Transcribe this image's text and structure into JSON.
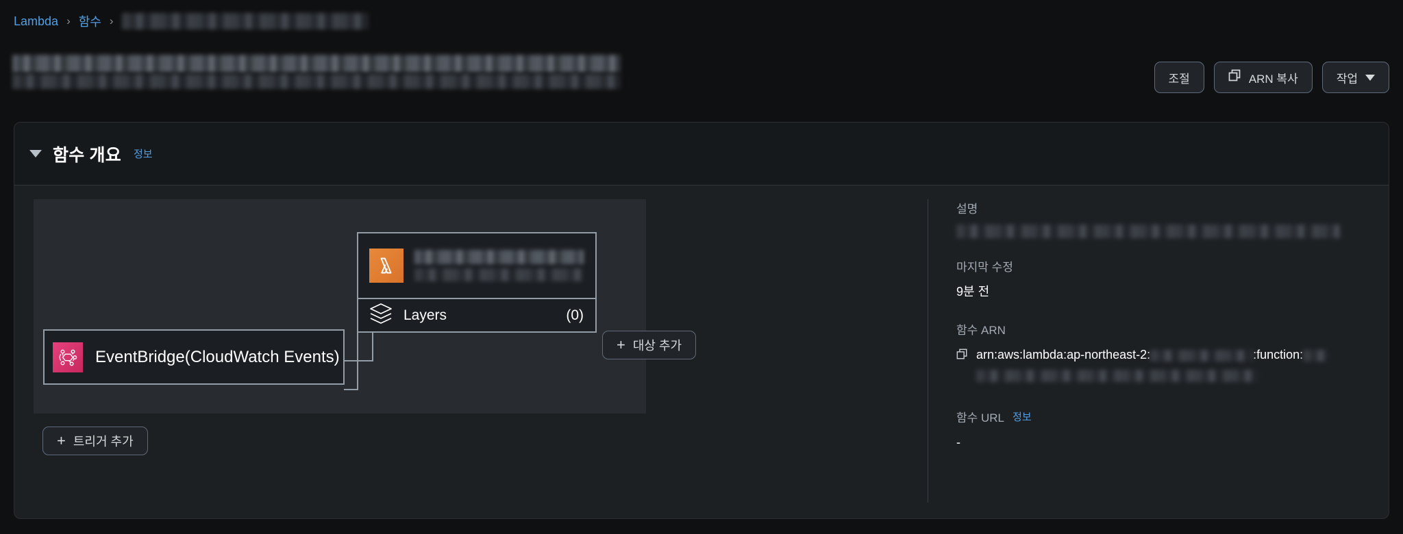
{
  "breadcrumb": {
    "items": [
      {
        "label": "Lambda",
        "link": true
      },
      {
        "label": "함수",
        "link": true
      }
    ],
    "separator": "›",
    "current_redacted": true
  },
  "page_title": {
    "redacted": true
  },
  "header_actions": {
    "throttle_label": "조절",
    "copy_arn_label": "ARN 복사",
    "copy_arn_icon": "copy-icon",
    "actions_label": "작업",
    "actions_caret_icon": "chevron-down-icon"
  },
  "overview_section": {
    "toggle_icon": "triangle-down-icon",
    "title": "함수 개요",
    "info_label": "정보"
  },
  "diagram": {
    "function_card": {
      "icon": "aws-lambda-icon",
      "name_redacted": true,
      "layers": {
        "icon": "layers-icon",
        "label": "Layers",
        "count": "(0)"
      }
    },
    "trigger_card": {
      "icon": "eventbridge-icon",
      "label": "EventBridge(CloudWatch Events)"
    },
    "add_trigger_button": {
      "plus": "+",
      "label": "트리거 추가"
    },
    "add_destination_button": {
      "plus": "+",
      "label": "대상 추가"
    }
  },
  "details": {
    "description": {
      "label": "설명",
      "value_redacted": true
    },
    "last_modified": {
      "label": "마지막 수정",
      "value": "9분 전"
    },
    "function_arn": {
      "label": "함수 ARN",
      "copy_icon": "copy-icon",
      "prefix": "arn:aws:lambda:ap-northeast-2:",
      "middle": ":function:",
      "account_redacted": true,
      "name_redacted": true
    },
    "function_url": {
      "label": "함수 URL",
      "info_label": "정보",
      "value": "-"
    }
  },
  "colors": {
    "page_background": "#0f1011",
    "panel_background": "#1d2023",
    "link_blue": "#539fe5",
    "lambda_orange": "#e8883a",
    "eventbridge_pink": "#e6407c",
    "border_gray": "#949ca5"
  }
}
